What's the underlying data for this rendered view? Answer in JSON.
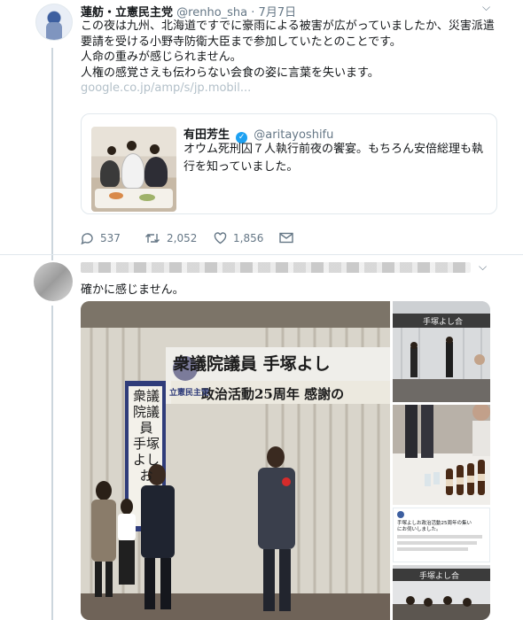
{
  "tweet": {
    "author_name": "蓮舫・立憲民主党",
    "author_handle": "@renho_sha",
    "date": "7月7日",
    "text": "この夜は九州、北海道ですでに豪雨による被害が広がっていましたか、災害派遣要請を受ける小野寺防衛大臣まで参加していたとのことです。\n人命の重みが感じられません。\n人権の感覚さえも伝わらない会食の姿に言葉を失います。",
    "link": "google.co.jp/amp/s/jp.mobil...",
    "quoted": {
      "author_name": "有田芳生",
      "author_handle": "@aritayoshifu",
      "text": "オウム死刑囚７人執行前夜の饗宴。もちろん安倍総理も執行を知っていました。"
    },
    "actions": {
      "replies": "537",
      "retweets": "2,052",
      "likes": "1,856"
    }
  },
  "reply": {
    "text": "確かに感じません。",
    "photo": {
      "banner_line1": "衆議院議員 手塚よし",
      "banner_line2": "政治活動25周年 感謝の",
      "party_sign": "立憲民主党",
      "vertical_sign": "衆議院議員 手塚よしお"
    },
    "thumb_banner": "手塚よし合",
    "embedded_tweet_lines": [
      "手塚よしお政治活動25周年の集い",
      "にお伺いしました。"
    ]
  },
  "colors": {
    "accent": "#1da1f2",
    "muted": "#657786",
    "border": "#e1e8ed"
  }
}
